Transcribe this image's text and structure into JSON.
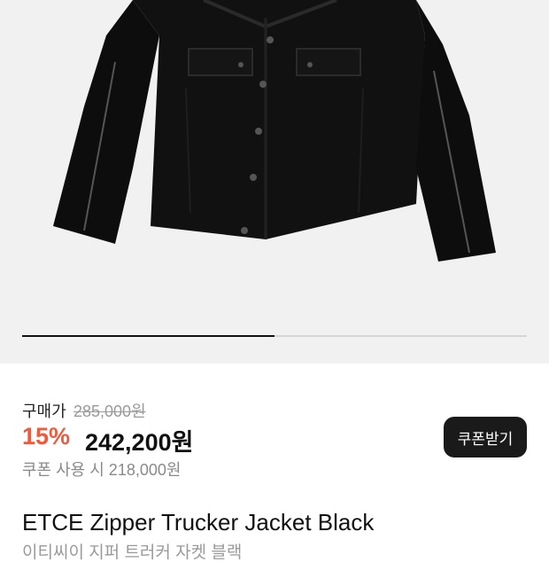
{
  "product_image": {
    "alt": "black zipper trucker jacket",
    "icon": "jacket-image"
  },
  "carousel": {
    "progress": 0.5
  },
  "price": {
    "label": "구매가",
    "original": "285,000원",
    "discount": "15%",
    "final": "242,200원",
    "coupon_note": "쿠폰 사용 시 218,000원",
    "discount_color": "#f05a3c"
  },
  "coupon_button": {
    "label": "쿠폰받기"
  },
  "product": {
    "title_en": "ETCE Zipper Trucker Jacket Black",
    "title_ko": "이티씨이 지퍼 트러커 자켓 블랙"
  }
}
